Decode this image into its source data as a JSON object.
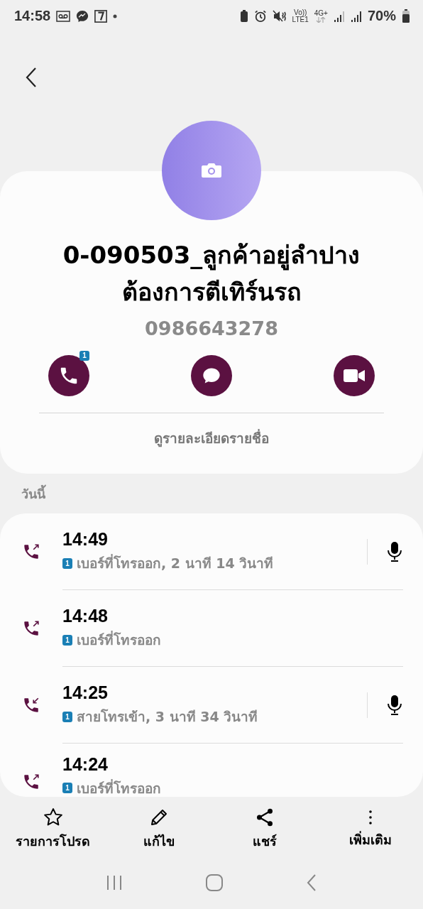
{
  "status_bar": {
    "time": "14:58",
    "volte_top": "Vo))",
    "volte_bottom": "LTE1",
    "network": "4G+",
    "battery": "70%"
  },
  "contact": {
    "name_lines": [
      "0-090503_ลูกค้าอยู่ลำปาง",
      "ต้องการตีเทิร์นรถ"
    ],
    "phone": "0986643278",
    "call_badge": "1",
    "details_link": "ดูรายละเอียดรายชื่อ"
  },
  "section_label": "วันนี้",
  "calls": [
    {
      "time": "14:49",
      "sim": "1",
      "detail": "เบอร์ที่โทรออก, 2 นาที 14 วินาที",
      "kind": "outgoing",
      "recorded": true
    },
    {
      "time": "14:48",
      "sim": "1",
      "detail": "เบอร์ที่โทรออก",
      "kind": "outgoing",
      "recorded": false
    },
    {
      "time": "14:25",
      "sim": "1",
      "detail": "สายโทรเข้า, 3 นาที 34 วินาที",
      "kind": "incoming",
      "recorded": true
    },
    {
      "time": "14:24",
      "sim": "1",
      "detail": "เบอร์ที่โทรออก",
      "kind": "outgoing",
      "recorded": false
    }
  ],
  "bottom_actions": [
    {
      "kind": "favorite",
      "label": "รายการโปรด"
    },
    {
      "kind": "edit",
      "label": "แก้ไข"
    },
    {
      "kind": "share",
      "label": "แชร์"
    },
    {
      "kind": "more",
      "label": "เพิ่มเติม"
    }
  ]
}
